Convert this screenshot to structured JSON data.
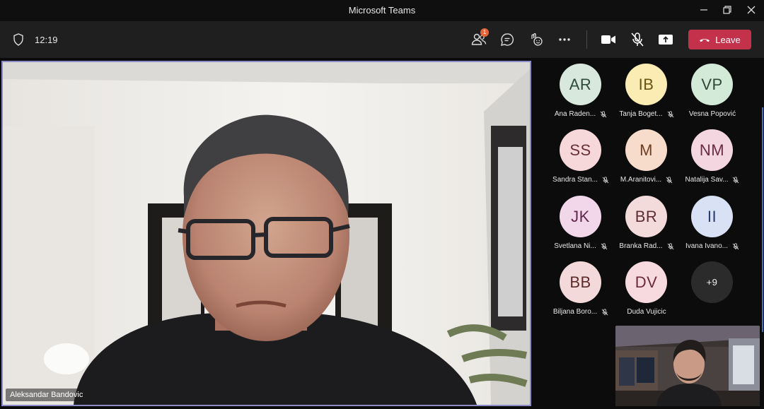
{
  "window": {
    "title": "Microsoft Teams"
  },
  "toolbar": {
    "time": "12:19",
    "participants_badge": "1",
    "leave_label": "Leave"
  },
  "main_video": {
    "name": "Aleksandar Bandovic"
  },
  "participants": [
    {
      "initials": "AR",
      "name": "Ana Raden...",
      "muted": true,
      "bg": "#d9e8dd",
      "fg": "#2e4b38"
    },
    {
      "initials": "IB",
      "name": "Tanja Boget...",
      "muted": true,
      "bg": "#fbecb4",
      "fg": "#6a5510"
    },
    {
      "initials": "VP",
      "name": "Vesna Popović",
      "muted": false,
      "bg": "#d3ead8",
      "fg": "#2c4a35"
    },
    {
      "initials": "SS",
      "name": "Sandra Stan...",
      "muted": true,
      "bg": "#f6d8da",
      "fg": "#6a2f35"
    },
    {
      "initials": "M",
      "name": "M.Aranitovi...",
      "muted": true,
      "bg": "#f7dccc",
      "fg": "#6e3c22"
    },
    {
      "initials": "NM",
      "name": "Natalija Sav...",
      "muted": true,
      "bg": "#f3d6e0",
      "fg": "#6a2b45"
    },
    {
      "initials": "JK",
      "name": "Svetlana Ni...",
      "muted": true,
      "bg": "#f2d7ea",
      "fg": "#62274f"
    },
    {
      "initials": "BR",
      "name": "Branka Rad...",
      "muted": true,
      "bg": "#f3dbdc",
      "fg": "#5e2d31"
    },
    {
      "initials": "II",
      "name": "Ivana Ivano...",
      "muted": true,
      "bg": "#d9e2f5",
      "fg": "#263c6a"
    },
    {
      "initials": "BB",
      "name": "Biljana Boro...",
      "muted": true,
      "bg": "#f3d9d9",
      "fg": "#5e2b2b"
    },
    {
      "initials": "DV",
      "name": "Duda Vujicic",
      "muted": false,
      "bg": "#f7d9e0",
      "fg": "#6b2a3c"
    }
  ],
  "overflow": {
    "label": "+9"
  },
  "colors": {
    "leave": "#c4314b",
    "active_border": "#8b8cc7",
    "badge": "#e3663a"
  },
  "icons": [
    "shield-icon",
    "people-icon",
    "chat-icon",
    "reactions-icon",
    "more-icon",
    "camera-icon",
    "mic-off-icon",
    "share-icon",
    "phone-hangup-icon",
    "minimize-icon",
    "restore-icon",
    "close-icon",
    "mic-muted-icon"
  ]
}
